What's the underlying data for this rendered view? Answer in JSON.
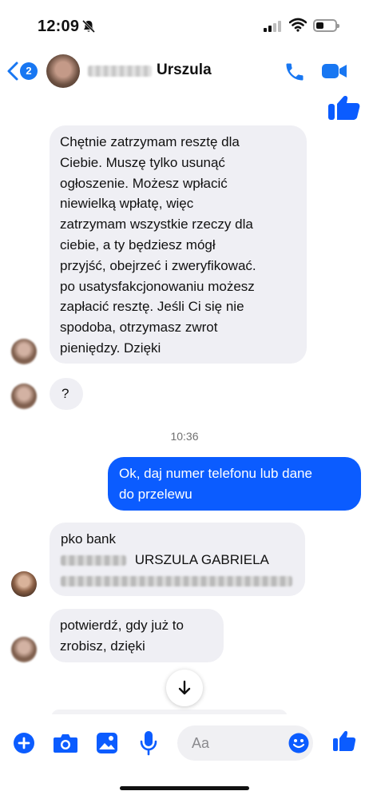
{
  "status": {
    "time": "12:09"
  },
  "header": {
    "contact_name": "Urszula",
    "back_badge": "2"
  },
  "messages": {
    "m1": [
      "Chętnie zatrzymam resztę dla",
      "Ciebie. Muszę tylko usunąć",
      "ogłoszenie. Możesz wpłacić",
      "niewielką wpłatę, więc",
      "zatrzymam wszystkie rzeczy dla",
      "ciebie, a ty będziesz mógł",
      "przyjść, obejrzeć i zweryfikować.",
      "po usatysfakcjonowaniu możesz",
      "zapłacić resztę. Jeśli Ci się nie",
      "spodoba, otrzymasz zwrot",
      "pieniędzy. Dzięki"
    ],
    "m2": "?",
    "timestamp": "10:36",
    "m3": [
      "Ok, daj numer telefonu lub dane",
      "do przelewu"
    ],
    "m4_line1": "pko bank",
    "m4_name": "URSZULA GABRIELA",
    "m5": [
      "potwierdź, gdy już to",
      "zrobisz, dzięki"
    ]
  },
  "composer": {
    "placeholder": "Aa"
  },
  "icons": {
    "back": "chevron-left-icon",
    "call": "phone-icon",
    "video": "video-camera-icon",
    "like": "thumbs-up-icon",
    "add": "plus-circle-icon",
    "camera": "camera-icon",
    "gallery": "image-icon",
    "mic": "microphone-icon",
    "emoji": "smiley-icon",
    "scroll": "arrow-down-icon",
    "mute": "bell-slash-icon"
  },
  "colors": {
    "accent": "#0b5cff",
    "incoming_bubble": "#efeff4",
    "icon_blue": "#1877f2"
  }
}
